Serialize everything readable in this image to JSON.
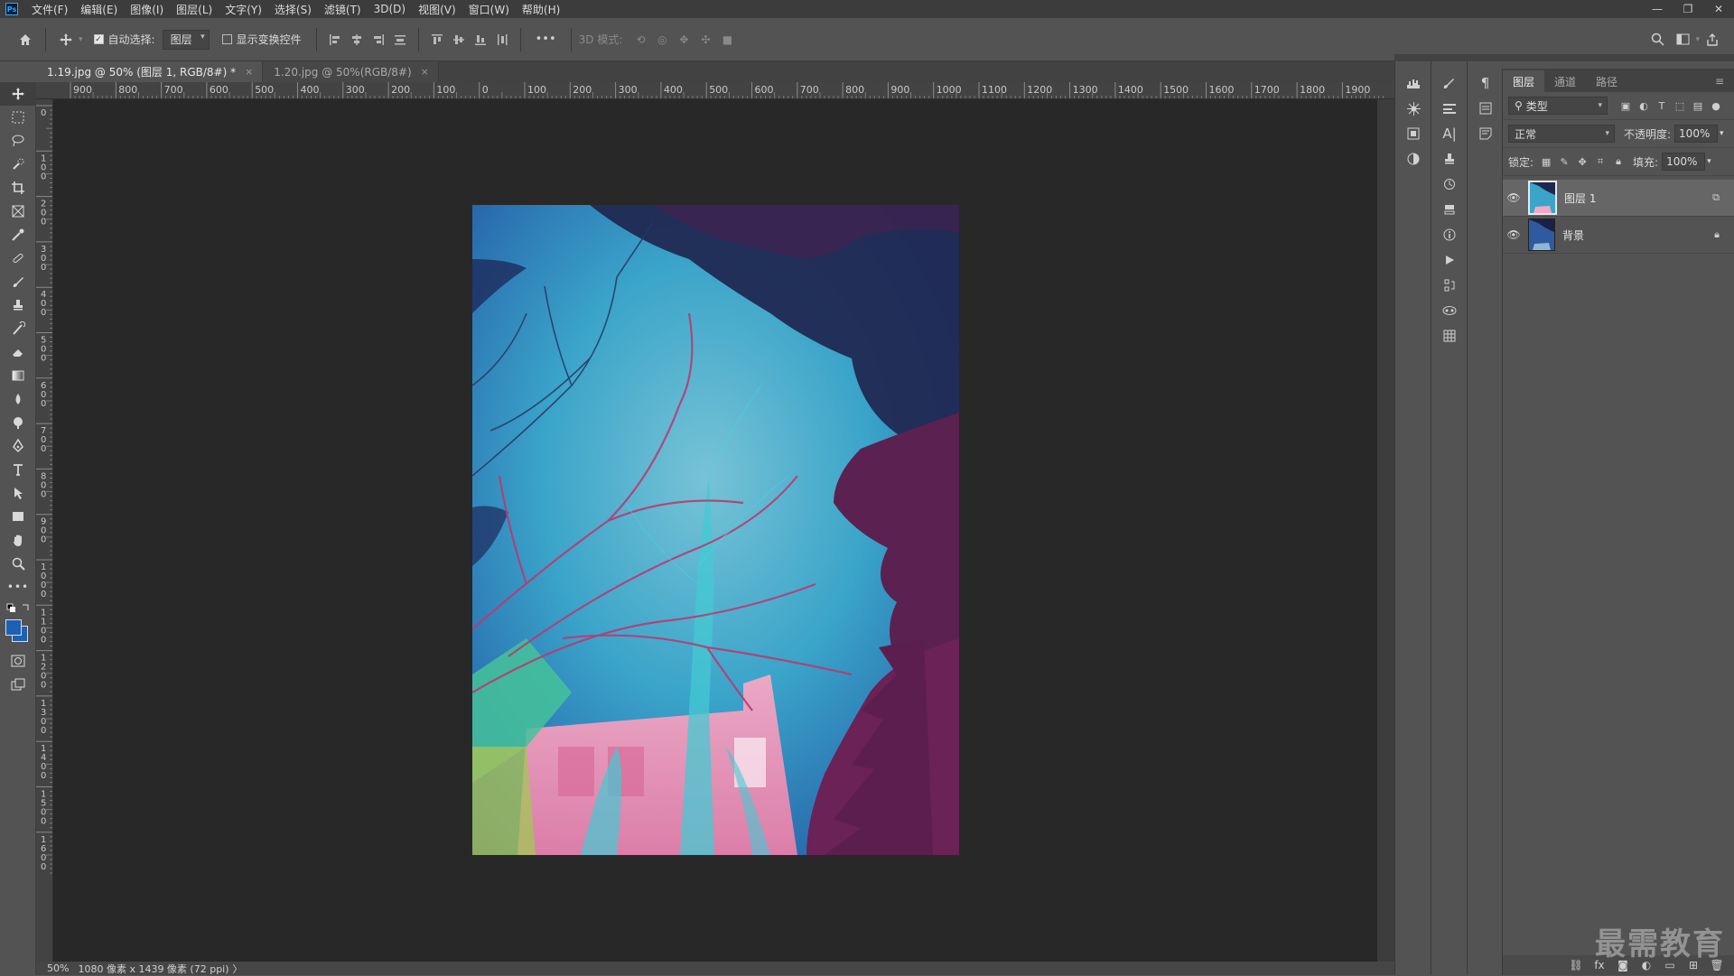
{
  "app": {
    "logo": "Ps"
  },
  "menu": [
    "文件(F)",
    "编辑(E)",
    "图像(I)",
    "图层(L)",
    "文字(Y)",
    "选择(S)",
    "滤镜(T)",
    "3D(D)",
    "视图(V)",
    "窗口(W)",
    "帮助(H)"
  ],
  "window_controls": {
    "minimize": "—",
    "restore": "❐",
    "close": "✕"
  },
  "options": {
    "auto_select_label": "自动选择:",
    "auto_select_value": "图层",
    "show_transform_label": "显示变换控件",
    "mode_3d_label": "3D 模式:",
    "more": "•••"
  },
  "tabs": [
    {
      "label": "1.19.jpg @ 50% (图层 1, RGB/8#) *",
      "close": "×"
    },
    {
      "label": "1.20.jpg @ 50%(RGB/8#)",
      "close": "×"
    }
  ],
  "ruler": {
    "top_labels": [
      "900",
      "800",
      "700",
      "600",
      "500",
      "400",
      "300",
      "200",
      "100",
      "0",
      "100",
      "200",
      "300",
      "400",
      "500",
      "600",
      "700",
      "800",
      "900",
      "1000",
      "1100",
      "1200",
      "1300",
      "1400",
      "1500",
      "1600",
      "1700",
      "1800",
      "1900"
    ],
    "left_labels": [
      "0",
      "100",
      "200",
      "300",
      "400",
      "500",
      "600",
      "700",
      "800",
      "900",
      "1000",
      "1100",
      "1200",
      "1300",
      "1400",
      "1500",
      "1600"
    ]
  },
  "status": {
    "zoom": "50%",
    "info": "1080 像素 x 1439 像素 (72 ppi)",
    "arrow": "〉"
  },
  "layers_panel": {
    "tabs": [
      "图层",
      "通道",
      "路径"
    ],
    "filter_label": "类型",
    "blend_mode": "正常",
    "opacity_label": "不透明度:",
    "opacity_value": "100%",
    "lock_label": "锁定:",
    "fill_label": "填充:",
    "fill_value": "100%",
    "layers": [
      {
        "name": "图层 1",
        "selected": true
      },
      {
        "name": "背景",
        "selected": false,
        "locked": true
      }
    ]
  },
  "watermark": "最需教育",
  "colors": {
    "foreground": "#1f5fb4",
    "background": "#1f5fb4",
    "accent_selection": "#666666"
  }
}
